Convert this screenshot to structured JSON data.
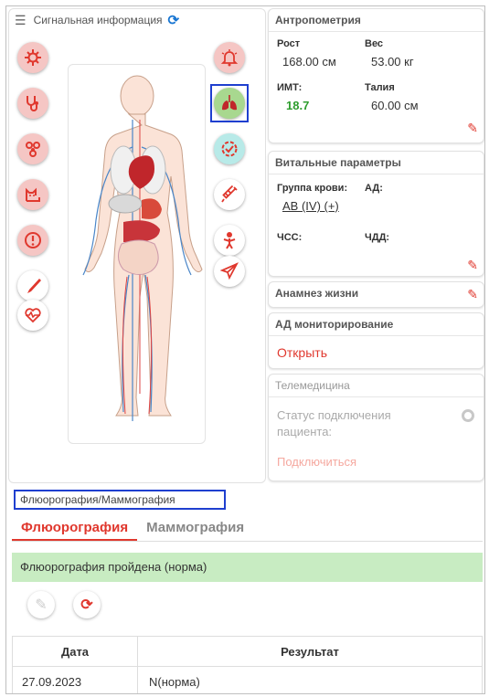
{
  "left_panel": {
    "title": "Сигнальная информация",
    "menu_icon": "hamburger-icon",
    "refresh_icon": "refresh-icon"
  },
  "left_icons": [
    {
      "name": "virus-icon",
      "style": "pink"
    },
    {
      "name": "stethoscope-icon",
      "style": "pink"
    },
    {
      "name": "biohazard-icon",
      "style": "pink"
    },
    {
      "name": "cat-allergy-icon",
      "style": "pink"
    },
    {
      "name": "exclamation-icon",
      "style": "pink"
    },
    {
      "name": "scalpel-icon",
      "style": "white"
    },
    {
      "name": "heartbeat-icon",
      "style": "white"
    }
  ],
  "right_icons": [
    {
      "name": "bell-icon",
      "style": "pink"
    },
    {
      "name": "lungs-icon",
      "style": "green"
    },
    {
      "name": "check-badge-icon",
      "style": "cyan"
    },
    {
      "name": "syringe-icon",
      "style": "white"
    },
    {
      "name": "baby-icon",
      "style": "white"
    },
    {
      "name": "paper-plane-icon",
      "style": "white"
    }
  ],
  "anthropometry": {
    "title": "Антропометрия",
    "height_label": "Рост",
    "height_value": "168.00 см",
    "weight_label": "Вес",
    "weight_value": "53.00 кг",
    "bmi_label": "ИМТ:",
    "bmi_value": "18.7",
    "waist_label": "Талия",
    "waist_value": "60.00 см"
  },
  "vitals": {
    "title": "Витальные параметры",
    "blood_group_label": "Группа крови:",
    "blood_group_value": "AB (IV) (+)",
    "bp_label": "АД:",
    "hr_label": "ЧСС:",
    "rr_label": "ЧДД:"
  },
  "anamnesis": {
    "title": "Анамнез жизни"
  },
  "bp_monitoring": {
    "title": "АД мониторирование",
    "link": "Открыть"
  },
  "telemedicine": {
    "title": "Телемедицина",
    "status_label": "Статус подключения пациента:",
    "connect_link": "Подключиться"
  },
  "fluoro_section": {
    "title": "Флюорография/Маммография",
    "tabs": [
      "Флюорография",
      "Маммография"
    ],
    "status": "Флюорография пройдена (норма)",
    "table": {
      "headers": [
        "Дата",
        "Результат"
      ],
      "rows": [
        [
          "27.09.2023",
          "N(норма)"
        ]
      ]
    }
  },
  "colors": {
    "accent_red": "#e0382e",
    "select_blue": "#1f3fcf",
    "bmi_green": "#2e9d2e",
    "status_green": "#c8ecc2"
  }
}
